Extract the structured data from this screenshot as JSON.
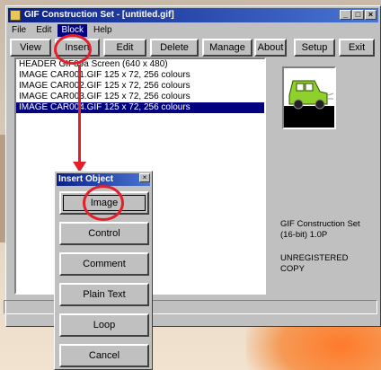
{
  "window": {
    "title": "GIF Construction Set - [untitled.gif]",
    "controls": {
      "minimize": "_",
      "maximize": "□",
      "close": "×"
    }
  },
  "menu": [
    "File",
    "Edit",
    "Block",
    "Help"
  ],
  "toolbar": [
    "View",
    "Insert",
    "Edit",
    "Delete",
    "Manage",
    "About",
    "Setup",
    "Exit"
  ],
  "list": [
    {
      "text": "HEADER GIF89a Screen (640 x 480)",
      "selected": false
    },
    {
      "text": "IMAGE CAR001.GIF 125 x 72, 256 colours",
      "selected": false
    },
    {
      "text": "IMAGE CAR002.GIF 125 x 72, 256 colours",
      "selected": false
    },
    {
      "text": "IMAGE CAR003.GIF 125 x 72, 256 colours",
      "selected": false
    },
    {
      "text": "IMAGE CAR004.GIF 125 x 72, 256 colours",
      "selected": true
    }
  ],
  "info": {
    "version": "GIF Construction Set (16-bit) 1.0P",
    "registration": "UNREGISTERED COPY"
  },
  "dialog": {
    "title": "Insert Object",
    "close": "×",
    "buttons": [
      "Image",
      "Control",
      "Comment",
      "Plain Text",
      "Loop",
      "Cancel"
    ]
  },
  "colors": {
    "annotation": "#e2202a",
    "titlebar": "#0a1f88",
    "selection": "#000080"
  }
}
